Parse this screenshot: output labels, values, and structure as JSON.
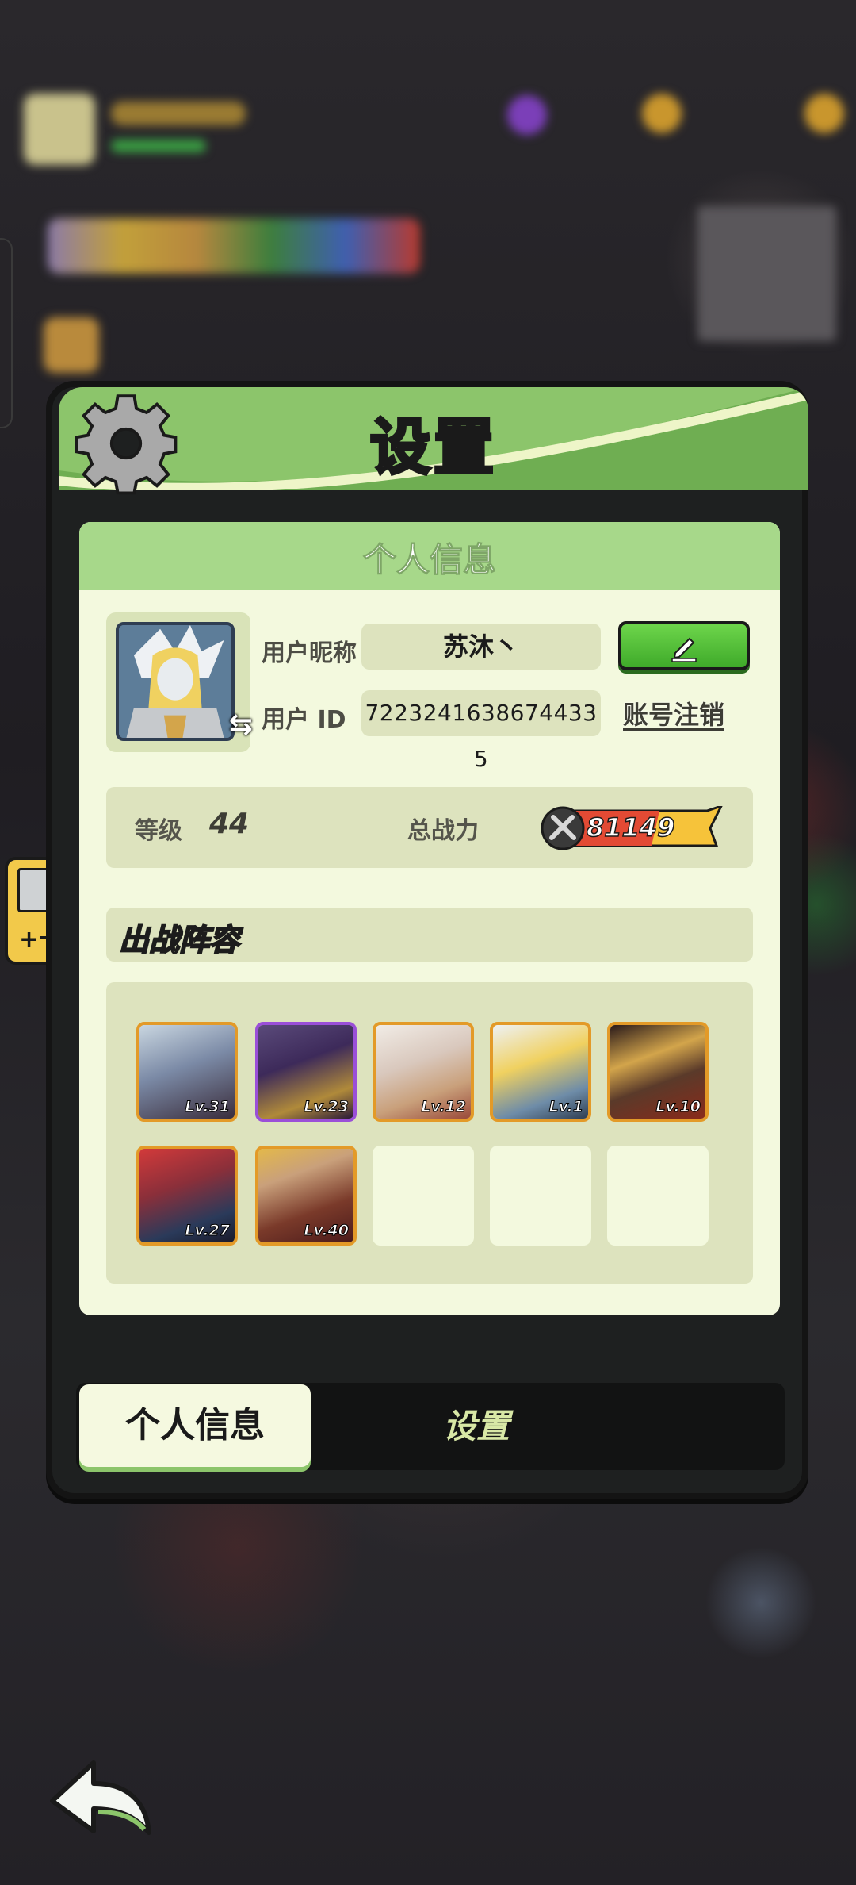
{
  "panel": {
    "title": "设置",
    "card_title": "个人信息"
  },
  "profile": {
    "nickname_label": "用户昵称",
    "nickname_value": "苏沐丶",
    "id_label": "用户 ID",
    "id_value": "7223241638674433 5",
    "cancel_account_label": "账号注销"
  },
  "stats": {
    "level_label": "等级",
    "level_value": "44",
    "power_label": "总战力",
    "power_value": "81149"
  },
  "team": {
    "title": "出战阵容",
    "heroes": [
      {
        "level": "Lv.31",
        "rarity": "legendary",
        "color": "#7b8aa6"
      },
      {
        "level": "Lv.23",
        "rarity": "epic",
        "color": "#3d2a5a"
      },
      {
        "level": "Lv.12",
        "rarity": "legendary",
        "color": "#c9a07b"
      },
      {
        "level": "Lv.1",
        "rarity": "legendary",
        "color": "#6e8ca8"
      },
      {
        "level": "Lv.10",
        "rarity": "legendary",
        "color": "#5a3a2a"
      },
      {
        "level": "Lv.27",
        "rarity": "legendary",
        "color": "#8a2f3a"
      },
      {
        "level": "Lv.40",
        "rarity": "legendary",
        "color": "#7a3a2a"
      }
    ]
  },
  "tabs": {
    "profile_tab": "个人信息",
    "settings_tab": "设置"
  },
  "colors": {
    "accent_green": "#8cc56b",
    "card_bg": "#f3f9de",
    "pill_bg": "#dde3be"
  }
}
